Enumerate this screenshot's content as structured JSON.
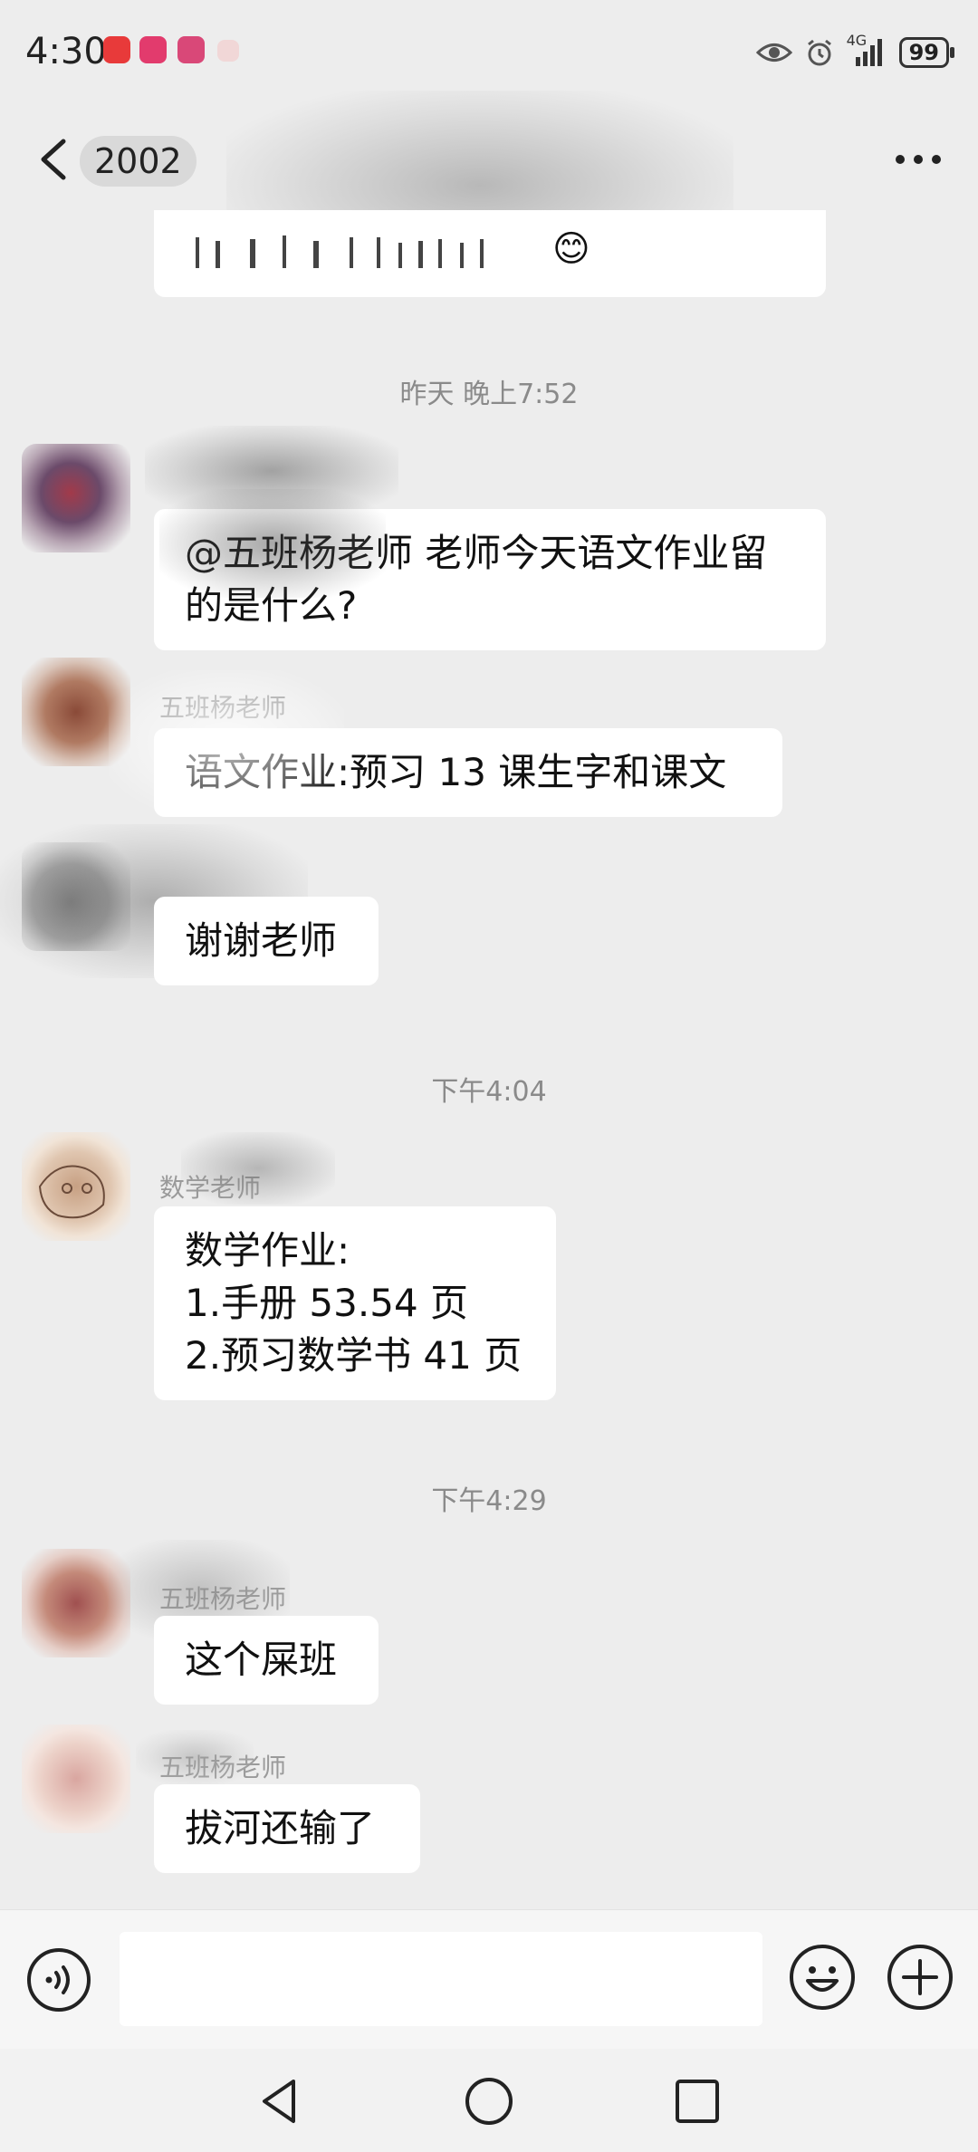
{
  "status_bar": {
    "time": "4:30",
    "network": "4G",
    "battery": "99"
  },
  "header": {
    "title": "2002"
  },
  "messages": {
    "top_partial_emoji": "😊",
    "ts1": "昨天 晚上7:52",
    "m1_text": "@五班杨老师  老师今天语文作业留的是什么?",
    "m2_sender": "五班杨老师",
    "m2_text": "语文作业:预习 13 课生字和课文",
    "m3_text": "谢谢老师",
    "ts2": "下午4:04",
    "m4_sender": "数学老师",
    "m4_line1": "数学作业:",
    "m4_line2": "1.手册 53.54 页",
    "m4_line3": "2.预习数学书 41 页",
    "ts3": "下午4:29",
    "m5_sender": "五班杨老师",
    "m5_text": "这个屎班",
    "m6_sender": "五班杨老师",
    "m6_text": "拔河还输了"
  },
  "colors": {
    "background": "#ededed",
    "bubble": "#ffffff",
    "timestamp": "#8a8a8a"
  }
}
